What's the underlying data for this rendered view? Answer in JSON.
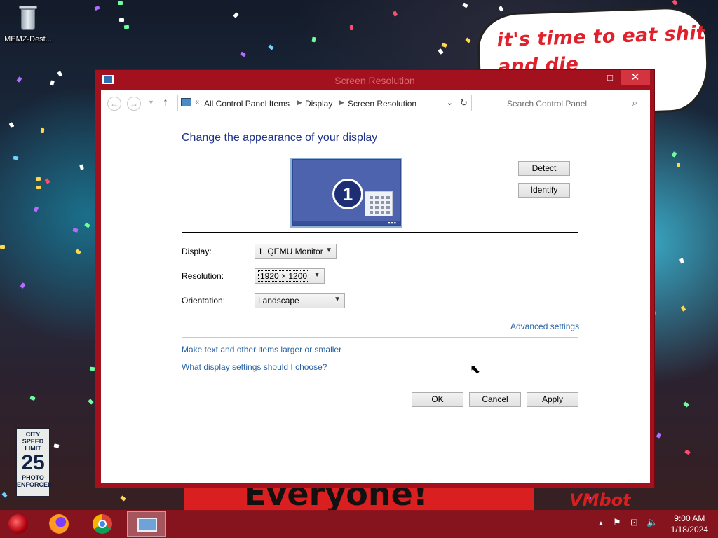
{
  "desktop": {
    "recycle_bin_label": "MEMZ-Dest...",
    "speech_bubble_line1": "it's time to eat shit",
    "speech_bubble_line2": "and die andcelebrate",
    "banner_text": "Everyone!",
    "watermark": "VMbot",
    "sign_line1": "CITY",
    "sign_line2": "SPEED",
    "sign_line3": "LIMIT",
    "sign_number": "25",
    "sign_line4": "PHOTO",
    "sign_line5": "ENFORCED"
  },
  "window": {
    "title": "Screen Resolution",
    "close_glyph": "✕",
    "minimize_glyph": "—",
    "maximize_glyph": "□"
  },
  "address_bar": {
    "prefix": "«",
    "breadcrumbs": [
      "All Control Panel Items",
      "Display",
      "Screen Resolution"
    ],
    "search_placeholder": "Search Control Panel"
  },
  "main": {
    "heading": "Change the appearance of your display",
    "monitor_number": "1",
    "detect_label": "Detect",
    "identify_label": "Identify",
    "display_label": "Display:",
    "display_value": "1. QEMU Monitor",
    "resolution_label": "Resolution:",
    "resolution_value": "1920 × 1200",
    "orientation_label": "Orientation:",
    "orientation_value": "Landscape",
    "advanced_link": "Advanced settings",
    "link_text_size": "Make text and other items larger or smaller",
    "link_display_help": "What display settings should I choose?",
    "ok_label": "OK",
    "cancel_label": "Cancel",
    "apply_label": "Apply"
  },
  "taskbar": {
    "time": "9:00 AM",
    "date": "1/18/2024",
    "apps": [
      "start-orb",
      "firefox",
      "chrome",
      "screen-resolution"
    ]
  },
  "colors": {
    "window_frame": "#a3101e",
    "heading_blue": "#1e3287",
    "link_blue": "#2a64a6",
    "taskbar": "#8c141e"
  }
}
